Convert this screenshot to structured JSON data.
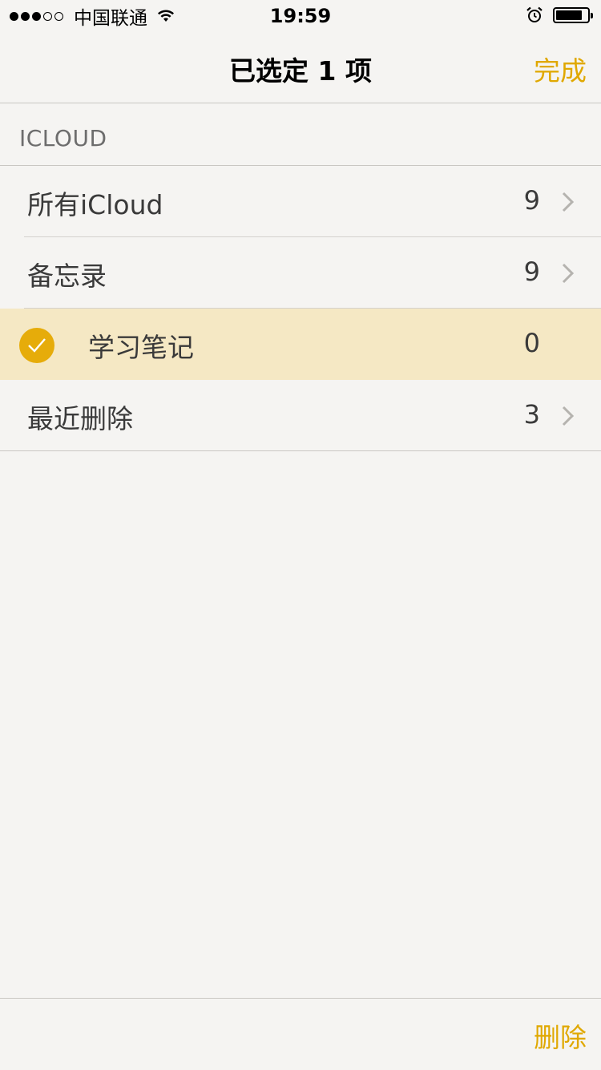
{
  "status_bar": {
    "signal_bars_filled": 3,
    "signal_bars_total": 5,
    "carrier": "中国联通",
    "wifi_icon": "wifi-icon",
    "time": "19:59",
    "alarm_icon": "alarm-icon",
    "battery_level": 0.85
  },
  "nav": {
    "title": "已选定 1 项",
    "done_label": "完成"
  },
  "section": {
    "header": "ICLOUD"
  },
  "folders": [
    {
      "label": "所有iCloud",
      "count": "9",
      "selected": false,
      "chevron": true
    },
    {
      "label": "备忘录",
      "count": "9",
      "selected": false,
      "chevron": true
    },
    {
      "label": "学习笔记",
      "count": "0",
      "selected": true,
      "chevron": false
    },
    {
      "label": "最近删除",
      "count": "3",
      "selected": false,
      "chevron": true
    }
  ],
  "toolbar": {
    "delete_label": "删除"
  },
  "colors": {
    "accent": "#e0a800",
    "selected_row": "#f5e8c4",
    "check_fill": "#e6ac0a",
    "background": "#f5f4f2"
  }
}
